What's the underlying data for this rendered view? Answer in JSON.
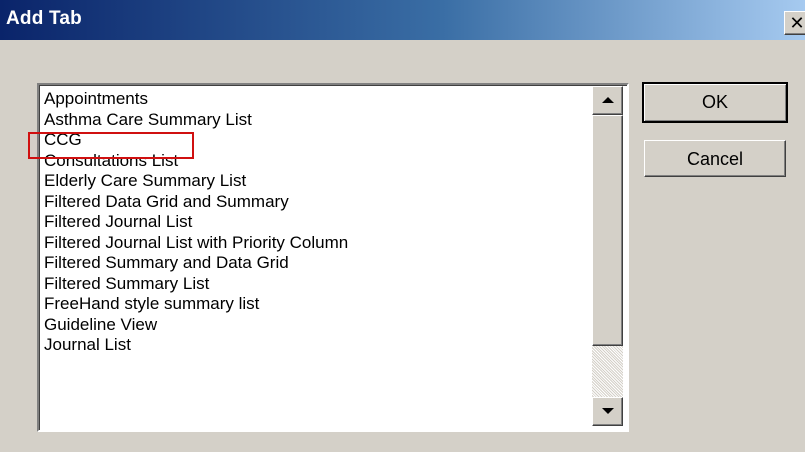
{
  "dialog": {
    "title": "Add Tab",
    "close_glyph": "✕"
  },
  "list": {
    "items": [
      "Appointments",
      "Asthma Care Summary List",
      "CCG",
      "Consultations List",
      "Elderly Care Summary List",
      "Filtered Data Grid and Summary",
      "Filtered Journal List",
      "Filtered Journal List with Priority Column",
      "Filtered Summary and Data Grid",
      "Filtered Summary List",
      "FreeHand style summary list",
      "Guideline View",
      "Journal List"
    ],
    "highlighted_item": "CCG"
  },
  "buttons": {
    "ok_label": "OK",
    "cancel_label": "Cancel"
  },
  "colors": {
    "title_gradient_start": "#0a246a",
    "title_gradient_end": "#a6caf0",
    "highlight_outline": "#d01010",
    "dialog_face": "#d4d0c8"
  },
  "icons": {
    "close": "close-icon",
    "scroll_up": "scroll-up-arrow-icon",
    "scroll_down": "scroll-down-arrow-icon"
  }
}
